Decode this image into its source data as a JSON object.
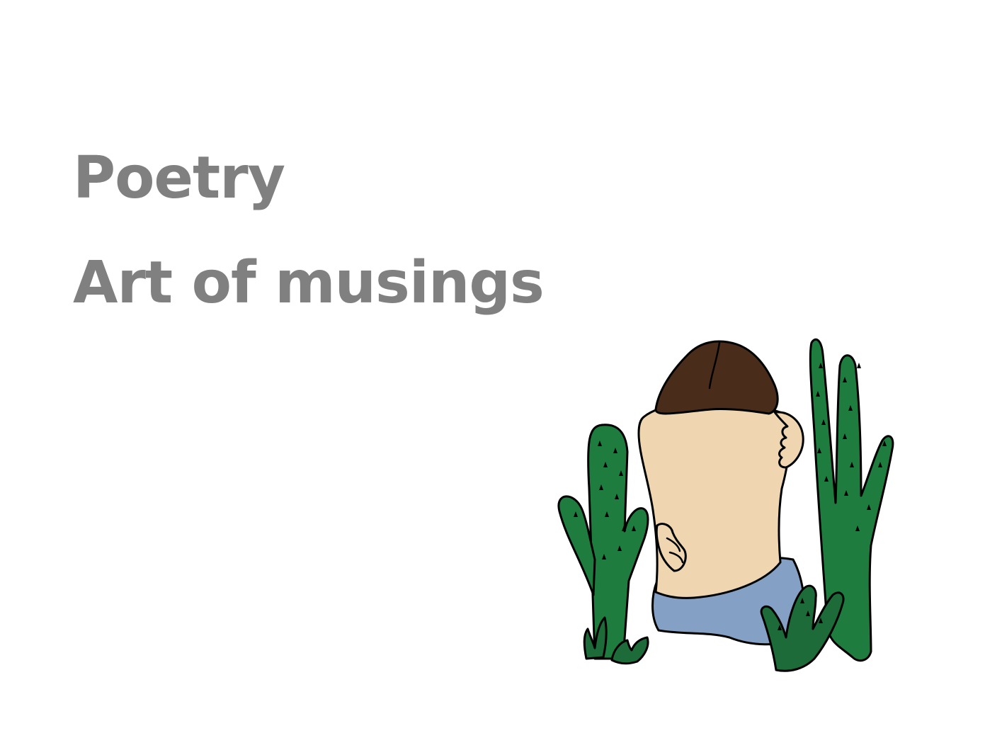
{
  "title": {
    "line1": "Poetry",
    "line2": "Art of musings"
  },
  "illustration": {
    "subject_icon": "person-among-cacti-illustration",
    "colors": {
      "text": "#808080",
      "hair": "#4a2c1a",
      "skin": "#efd6b1",
      "pants": "#84a0c4",
      "cactus": "#1e7d3e",
      "cactus_dark": "#1c6b38",
      "outline": "#000000"
    }
  }
}
